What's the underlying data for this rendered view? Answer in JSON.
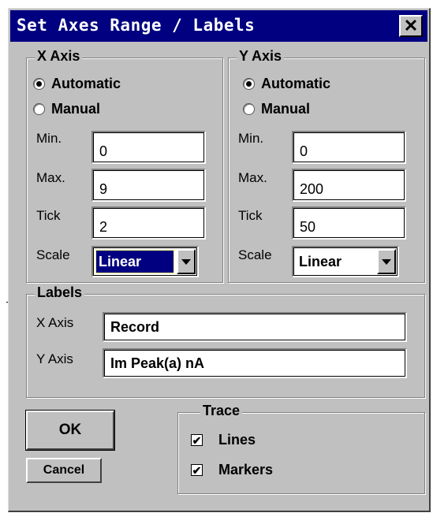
{
  "window": {
    "title": "Set Axes Range / Labels",
    "close_glyph": "✕"
  },
  "x_axis": {
    "group_label": "X Axis",
    "automatic_label": "Automatic",
    "manual_label": "Manual",
    "mode": "automatic",
    "min_label": "Min.",
    "min_value": "0",
    "max_label": "Max.",
    "max_value": "9",
    "tick_label": "Tick",
    "tick_value": "2",
    "scale_label": "Scale",
    "scale_value": "Linear"
  },
  "y_axis": {
    "group_label": "Y Axis",
    "automatic_label": "Automatic",
    "manual_label": "Manual",
    "mode": "automatic",
    "min_label": "Min.",
    "min_value": "0",
    "max_label": "Max.",
    "max_value": "200",
    "tick_label": "Tick",
    "tick_value": "50",
    "scale_label": "Scale",
    "scale_value": "Linear"
  },
  "labels": {
    "group_label": "Labels",
    "x_label": "X Axis",
    "x_value": "Record",
    "y_label": "Y Axis",
    "y_value": "Im Peak(a) nA"
  },
  "buttons": {
    "ok": "OK",
    "cancel": "Cancel"
  },
  "trace": {
    "group_label": "Trace",
    "lines_label": "Lines",
    "lines_checked": true,
    "markers_label": "Markers",
    "markers_checked": true
  },
  "colors": {
    "title_bar": "#000080",
    "face": "#c0c0c0",
    "selection": "#000080"
  }
}
